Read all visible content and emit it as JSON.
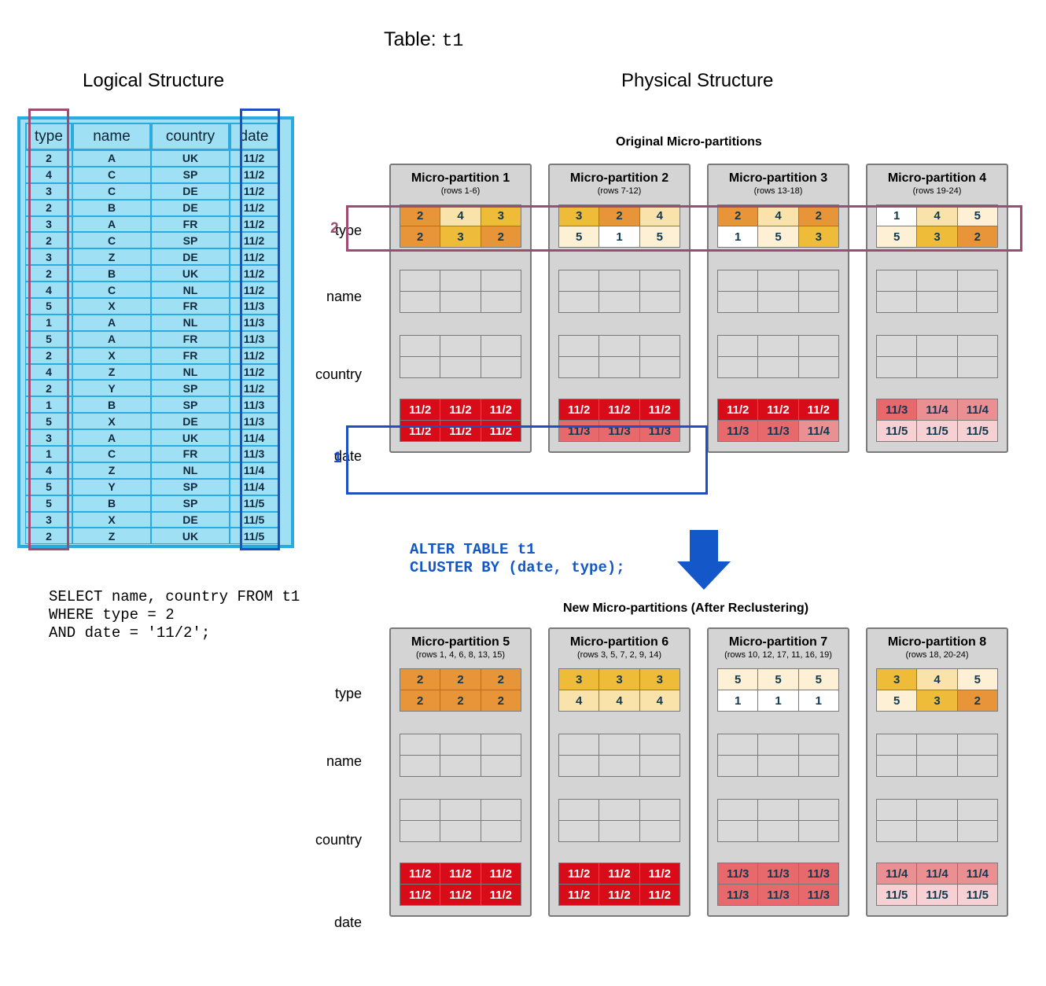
{
  "titles": {
    "table_label": "Table: ",
    "table_name": "t1",
    "logical": "Logical Structure",
    "physical": "Physical Structure",
    "original_partitions": "Original Micro-partitions",
    "new_partitions": "New Micro-partitions (After Reclustering)"
  },
  "markers": {
    "type_marker": "2",
    "date_marker": "1"
  },
  "colors": {
    "logical_fill": "#9fe0f5",
    "logical_border": "#29abe2",
    "type_highlight": "#9e4c72",
    "date_highlight": "#1f4fc4",
    "partition_bg": "#d4d4d4",
    "partition_border": "#7a7a7a",
    "sql_blue": "#1357c8",
    "arrow_blue": "#1357c8",
    "type_1": "#ffffff",
    "type_2": "#e8953a",
    "type_3": "#efbc3a",
    "type_4": "#fae3aa",
    "type_5": "#fdf0d5",
    "date_112": "#d80c18",
    "date_113": "#e8696c",
    "date_114": "#ea9093",
    "date_115": "#f6d0d2"
  },
  "logical_table": {
    "columns": [
      "type",
      "name",
      "country",
      "date"
    ],
    "rows": [
      [
        "2",
        "A",
        "UK",
        "11/2"
      ],
      [
        "4",
        "C",
        "SP",
        "11/2"
      ],
      [
        "3",
        "C",
        "DE",
        "11/2"
      ],
      [
        "2",
        "B",
        "DE",
        "11/2"
      ],
      [
        "3",
        "A",
        "FR",
        "11/2"
      ],
      [
        "2",
        "C",
        "SP",
        "11/2"
      ],
      [
        "3",
        "Z",
        "DE",
        "11/2"
      ],
      [
        "2",
        "B",
        "UK",
        "11/2"
      ],
      [
        "4",
        "C",
        "NL",
        "11/2"
      ],
      [
        "5",
        "X",
        "FR",
        "11/3"
      ],
      [
        "1",
        "A",
        "NL",
        "11/3"
      ],
      [
        "5",
        "A",
        "FR",
        "11/3"
      ],
      [
        "2",
        "X",
        "FR",
        "11/2"
      ],
      [
        "4",
        "Z",
        "NL",
        "11/2"
      ],
      [
        "2",
        "Y",
        "SP",
        "11/2"
      ],
      [
        "1",
        "B",
        "SP",
        "11/3"
      ],
      [
        "5",
        "X",
        "DE",
        "11/3"
      ],
      [
        "3",
        "A",
        "UK",
        "11/4"
      ],
      [
        "1",
        "C",
        "FR",
        "11/3"
      ],
      [
        "4",
        "Z",
        "NL",
        "11/4"
      ],
      [
        "5",
        "Y",
        "SP",
        "11/4"
      ],
      [
        "5",
        "B",
        "SP",
        "11/5"
      ],
      [
        "3",
        "X",
        "DE",
        "11/5"
      ],
      [
        "2",
        "Z",
        "UK",
        "11/5"
      ]
    ]
  },
  "queries": {
    "select": "SELECT name, country FROM t1\nWHERE type = 2\nAND date = '11/2';",
    "alter": "ALTER TABLE t1\nCLUSTER BY (date, type);"
  },
  "row_labels": [
    "type",
    "name",
    "country",
    "date"
  ],
  "original_partitions": [
    {
      "name": "Micro-partition 1",
      "rows": "(rows 1-6)",
      "type": [
        "2",
        "4",
        "3",
        "2",
        "3",
        "2"
      ],
      "date": [
        "11/2",
        "11/2",
        "11/2",
        "11/2",
        "11/2",
        "11/2"
      ]
    },
    {
      "name": "Micro-partition 2",
      "rows": "(rows 7-12)",
      "type": [
        "3",
        "2",
        "4",
        "5",
        "1",
        "5"
      ],
      "date": [
        "11/2",
        "11/2",
        "11/2",
        "11/3",
        "11/3",
        "11/3"
      ]
    },
    {
      "name": "Micro-partition 3",
      "rows": "(rows 13-18)",
      "type": [
        "2",
        "4",
        "2",
        "1",
        "5",
        "3"
      ],
      "date": [
        "11/2",
        "11/2",
        "11/2",
        "11/3",
        "11/3",
        "11/4"
      ]
    },
    {
      "name": "Micro-partition 4",
      "rows": "(rows 19-24)",
      "type": [
        "1",
        "4",
        "5",
        "5",
        "3",
        "2"
      ],
      "date": [
        "11/3",
        "11/4",
        "11/4",
        "11/5",
        "11/5",
        "11/5"
      ]
    }
  ],
  "new_partitions": [
    {
      "name": "Micro-partition 5",
      "rows": "(rows 1, 4, 6, 8, 13, 15)",
      "type": [
        "2",
        "2",
        "2",
        "2",
        "2",
        "2"
      ],
      "date": [
        "11/2",
        "11/2",
        "11/2",
        "11/2",
        "11/2",
        "11/2"
      ]
    },
    {
      "name": "Micro-partition 6",
      "rows": "(rows 3, 5, 7, 2, 9, 14)",
      "type": [
        "3",
        "3",
        "3",
        "4",
        "4",
        "4"
      ],
      "date": [
        "11/2",
        "11/2",
        "11/2",
        "11/2",
        "11/2",
        "11/2"
      ]
    },
    {
      "name": "Micro-partition 7",
      "rows": "(rows 10, 12, 17, 11, 16, 19)",
      "type": [
        "5",
        "5",
        "5",
        "1",
        "1",
        "1"
      ],
      "date": [
        "11/3",
        "11/3",
        "11/3",
        "11/3",
        "11/3",
        "11/3"
      ]
    },
    {
      "name": "Micro-partition 8",
      "rows": "(rows  18, 20-24)",
      "type": [
        "3",
        "4",
        "5",
        "5",
        "3",
        "2"
      ],
      "date": [
        "11/4",
        "11/4",
        "11/4",
        "11/5",
        "11/5",
        "11/5"
      ]
    }
  ]
}
